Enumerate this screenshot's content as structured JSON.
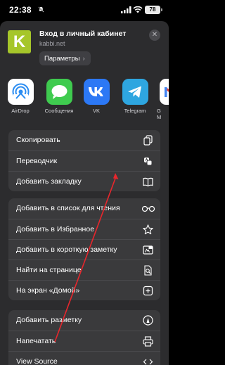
{
  "status_bar": {
    "time": "22:38",
    "battery": "78"
  },
  "header": {
    "logo_letter": "K",
    "title": "Вход в личный кабинет",
    "url": "kabbi.net",
    "options_button": "Параметры",
    "options_chevron": "›",
    "close_glyph": "✕"
  },
  "apps": [
    {
      "label": "AirDrop",
      "icon": "airdrop-icon"
    },
    {
      "label": "Сообщения",
      "icon": "messages-icon"
    },
    {
      "label": "VK",
      "icon": "vk-icon"
    },
    {
      "label": "Telegram",
      "icon": "telegram-icon"
    },
    {
      "label": "G\nM",
      "icon": "gmail-icon"
    }
  ],
  "groups": [
    [
      {
        "label": "Скопировать",
        "icon": "copy-icon"
      },
      {
        "label": "Переводчик",
        "icon": "translate-icon"
      },
      {
        "label": "Добавить закладку",
        "icon": "book-icon"
      }
    ],
    [
      {
        "label": "Добавить в список для чтения",
        "icon": "glasses-icon"
      },
      {
        "label": "Добавить в Избранное",
        "icon": "star-icon"
      },
      {
        "label": "Добавить в короткую заметку",
        "icon": "quick-note-icon"
      },
      {
        "label": "Найти на странице",
        "icon": "find-in-page-icon"
      },
      {
        "label": "На экран «Домой»",
        "icon": "add-square-icon"
      }
    ],
    [
      {
        "label": "Добавить разметку",
        "icon": "markup-icon"
      },
      {
        "label": "Напечатать",
        "icon": "printer-icon"
      },
      {
        "label": "View Source",
        "icon": "source-icon"
      }
    ]
  ],
  "colors": {
    "sheet_background": "#2c2c2e",
    "group_background": "#3a3a3c",
    "annotation_arrow": "#e8262c",
    "logo_background": "#a6c62a"
  }
}
